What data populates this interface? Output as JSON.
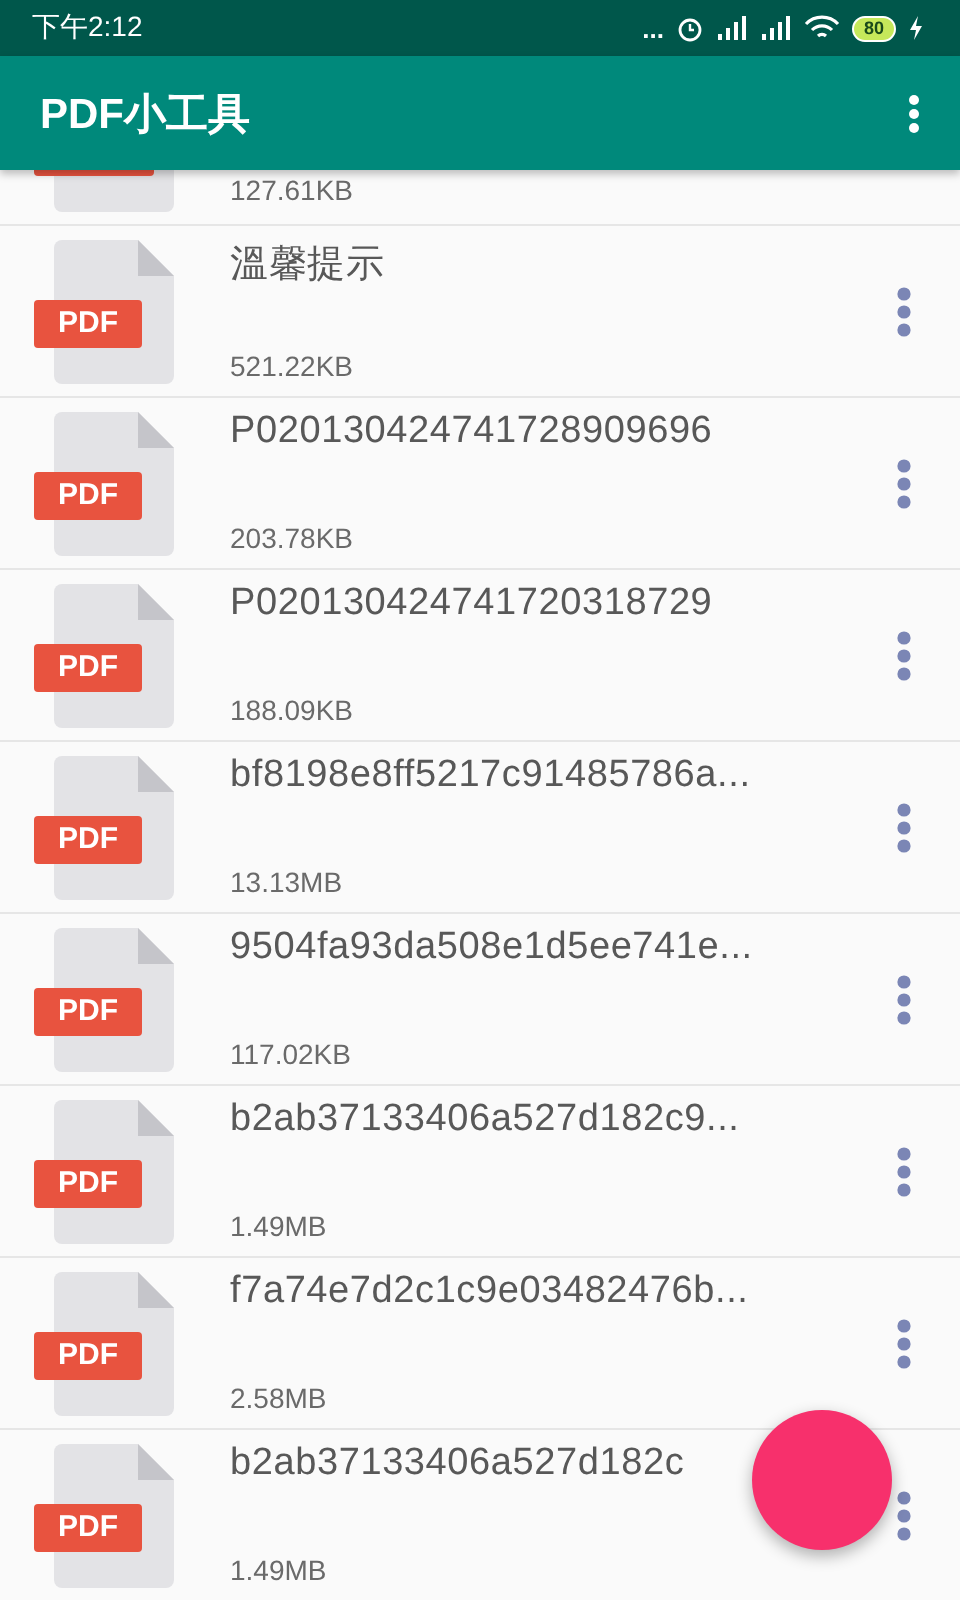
{
  "status_bar": {
    "time": "下午2:12",
    "more": "...",
    "battery": "80"
  },
  "app_bar": {
    "title": "PDF小工具"
  },
  "files": [
    {
      "kind": "partial",
      "size": "127.61KB"
    },
    {
      "kind": "full",
      "badge": "PDF",
      "name": "溫馨提示",
      "size": "521.22KB"
    },
    {
      "kind": "full",
      "badge": "PDF",
      "name": "P020130424741728909696",
      "size": "203.78KB"
    },
    {
      "kind": "full",
      "badge": "PDF",
      "name": "P020130424741720318729",
      "size": "188.09KB"
    },
    {
      "kind": "full",
      "badge": "PDF",
      "name": "bf8198e8ff5217c91485786a...",
      "size": "13.13MB"
    },
    {
      "kind": "full",
      "badge": "PDF",
      "name": "9504fa93da508e1d5ee741e...",
      "size": "117.02KB"
    },
    {
      "kind": "full",
      "badge": "PDF",
      "name": "b2ab37133406a527d182c9...",
      "size": "1.49MB"
    },
    {
      "kind": "full",
      "badge": "PDF",
      "name": "f7a74e7d2c1c9e03482476b...",
      "size": "2.58MB"
    },
    {
      "kind": "full",
      "badge": "PDF",
      "name": "b2ab37133406a527d182c",
      "size": "1.49MB"
    }
  ],
  "fab": {
    "kind": "floating"
  }
}
